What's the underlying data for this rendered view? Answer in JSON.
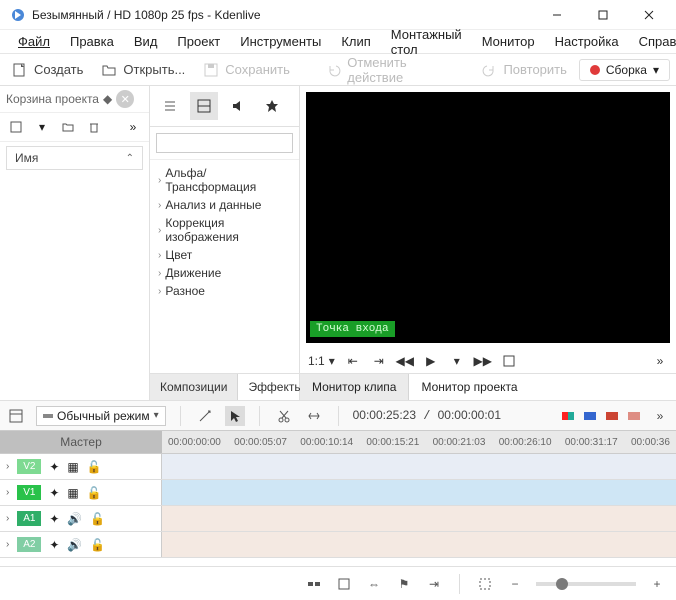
{
  "title": "Безымянный / HD 1080p 25 fps - Kdenlive",
  "menu": [
    "Файл",
    "Правка",
    "Вид",
    "Проект",
    "Инструменты",
    "Клип",
    "Монтажный стол",
    "Монитор",
    "Настройка",
    "Справка"
  ],
  "toolbar": {
    "create": "Создать",
    "open": "Открыть...",
    "save": "Сохранить",
    "undo": "Отменить действие",
    "redo": "Повторить",
    "render": "Сборка"
  },
  "projectBin": {
    "title": "Корзина проекта",
    "nameHeader": "Имя"
  },
  "effectsTree": [
    "Альфа/Трансформация",
    "Анализ и данные",
    "Коррекция изображения",
    "Цвет",
    "Движение",
    "Разное"
  ],
  "effectsTabs": {
    "compositions": "Композиции",
    "effects": "Эффекты"
  },
  "monitor": {
    "entry": "Точка входа",
    "zoom": "1:1",
    "clip": "Монитор клипа",
    "project": "Монитор проекта"
  },
  "modeDd": "Обычный режим",
  "timecode": {
    "cur": "00:00:25:23",
    "total": "00:00:00:01"
  },
  "ruler": [
    "00:00:00:00",
    "00:00:05:07",
    "00:00:10:14",
    "00:00:15:21",
    "00:00:21:03",
    "00:00:26:10",
    "00:00:31:17",
    "00:00:36"
  ],
  "tracks": {
    "master": "Мастер",
    "v2": "V2",
    "v1": "V1",
    "a1": "A1",
    "a2": "A2"
  }
}
